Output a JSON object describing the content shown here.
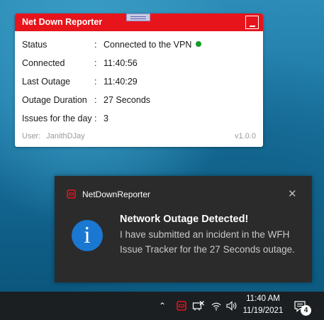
{
  "reporter": {
    "title": "Net Down Reporter",
    "rows": [
      {
        "label": "Status",
        "colon": ":",
        "value": "Connected to the VPN"
      },
      {
        "label": "Connected",
        "colon": ":",
        "value": "11:40:56"
      },
      {
        "label": "Last Outage",
        "colon": ":",
        "value": "11:40:29"
      },
      {
        "label": "Outage Duration",
        "colon": ":",
        "value": "27 Seconds"
      },
      {
        "label": "Issues for the day",
        "colon": ":",
        "value": "3"
      }
    ],
    "status_color": "#159a26",
    "user_label": "User:",
    "user_name": "JanithDJay",
    "version": "v1.0.0",
    "accent": "#e8141b"
  },
  "toast": {
    "app_name": "NetDownReporter",
    "close_glyph": "✕",
    "info_glyph": "i",
    "heading": "Network Outage Detected!",
    "body": "I have submitted an incident in the WFH Issue Tracker for the 27 Seconds outage."
  },
  "taskbar": {
    "chevron": "⌃",
    "time": "11:40 AM",
    "date": "11/19/2021",
    "notification_count": "4"
  }
}
